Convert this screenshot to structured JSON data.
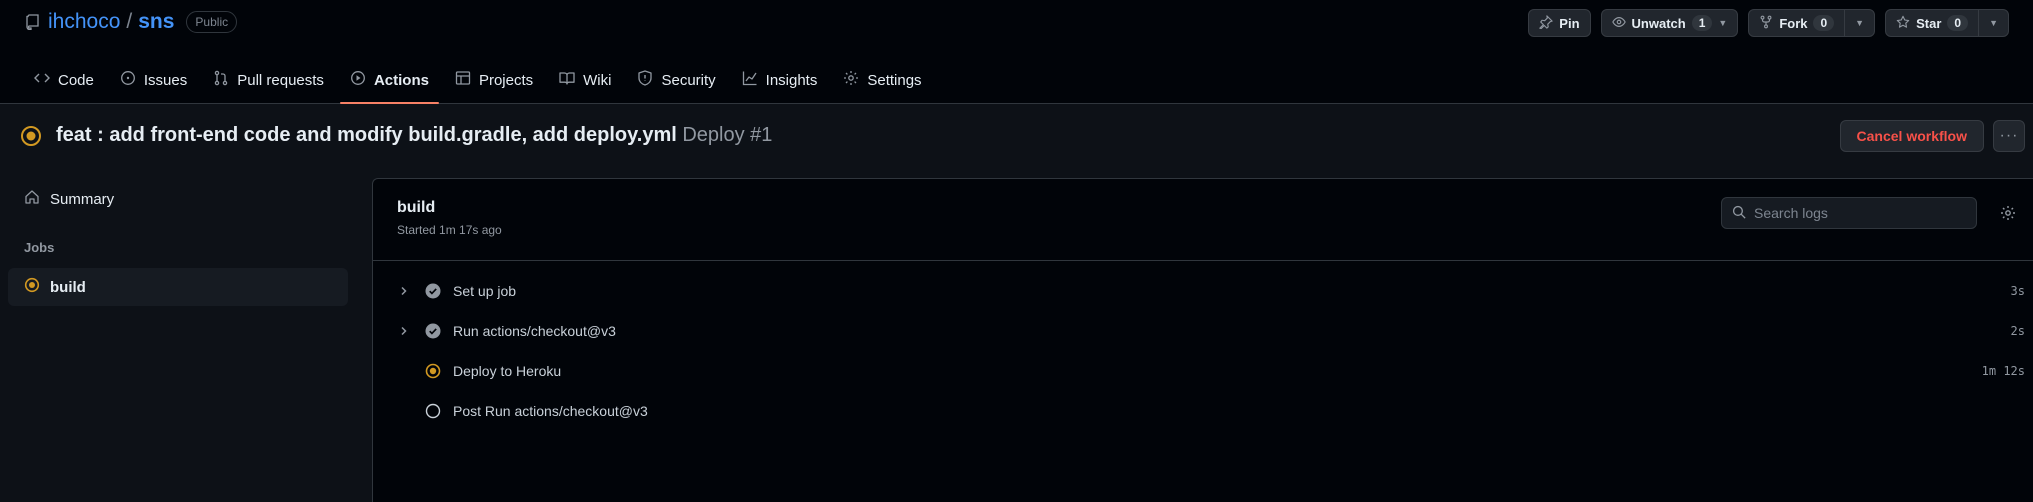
{
  "repo": {
    "owner": "ihchoco",
    "separator": "/",
    "name": "sns",
    "visibility": "Public"
  },
  "actions": {
    "pin_label": "Pin",
    "unwatch_label": "Unwatch",
    "unwatch_count": "1",
    "fork_label": "Fork",
    "fork_count": "0",
    "star_label": "Star",
    "star_count": "0"
  },
  "tabs": [
    {
      "label": "Code",
      "icon": "code-icon"
    },
    {
      "label": "Issues",
      "icon": "issue-icon"
    },
    {
      "label": "Pull requests",
      "icon": "pull-request-icon"
    },
    {
      "label": "Actions",
      "icon": "play-icon",
      "active": true
    },
    {
      "label": "Projects",
      "icon": "table-icon"
    },
    {
      "label": "Wiki",
      "icon": "book-icon"
    },
    {
      "label": "Security",
      "icon": "shield-icon"
    },
    {
      "label": "Insights",
      "icon": "graph-icon"
    },
    {
      "label": "Settings",
      "icon": "gear-icon"
    }
  ],
  "run": {
    "title": "feat : add front-end code and modify build.gradle, add deploy.yml",
    "subtitle": "Deploy #1",
    "status": "in_progress",
    "cancel_label": "Cancel workflow",
    "more_label": "···"
  },
  "sidebar": {
    "summary_label": "Summary",
    "jobs_label": "Jobs",
    "jobs": [
      {
        "label": "build",
        "status": "in_progress",
        "selected": true
      }
    ]
  },
  "job": {
    "title": "build",
    "started": "Started 1m 17s ago",
    "search_placeholder": "Search logs",
    "steps": [
      {
        "name": "Set up job",
        "status": "success",
        "expandable": true,
        "duration": "3s"
      },
      {
        "name": "Run actions/checkout@v3",
        "status": "success",
        "expandable": true,
        "duration": "2s"
      },
      {
        "name": "Deploy to Heroku",
        "status": "in_progress",
        "expandable": false,
        "duration": "1m 12s"
      },
      {
        "name": "Post Run actions/checkout@v3",
        "status": "queued",
        "expandable": false,
        "duration": ""
      }
    ]
  },
  "colors": {
    "accent_link": "#4493f8",
    "in_progress": "#d29922",
    "success_check": "#9198a1",
    "danger": "#f85149",
    "tab_underline": "#f78166"
  }
}
